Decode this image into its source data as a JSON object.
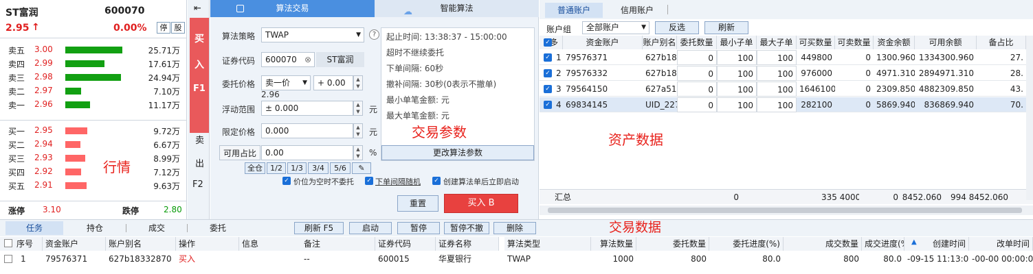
{
  "quote": {
    "name": "ST富润",
    "code": "600070",
    "price": "2.95",
    "arrow": "↑",
    "change_pct": "0.00%",
    "btn_stop": "停",
    "btn_stock": "股",
    "asks": [
      {
        "label": "卖五",
        "price": "3.00",
        "vol": "25.71万",
        "level": 0.83
      },
      {
        "label": "卖四",
        "price": "2.99",
        "vol": "17.61万",
        "level": 0.57
      },
      {
        "label": "卖三",
        "price": "2.98",
        "vol": "24.94万",
        "level": 0.81
      },
      {
        "label": "卖二",
        "price": "2.97",
        "vol": "7.10万",
        "level": 0.23
      },
      {
        "label": "卖一",
        "price": "2.96",
        "vol": "11.17万",
        "level": 0.36
      }
    ],
    "bids": [
      {
        "label": "买一",
        "price": "2.95",
        "vol": "9.72万",
        "level": 0.32
      },
      {
        "label": "买二",
        "price": "2.94",
        "vol": "6.67万",
        "level": 0.22
      },
      {
        "label": "买三",
        "price": "2.93",
        "vol": "8.99万",
        "level": 0.29
      },
      {
        "label": "买四",
        "price": "2.92",
        "vol": "7.12万",
        "level": 0.23
      },
      {
        "label": "买五",
        "price": "2.91",
        "vol": "9.63万",
        "level": 0.31
      }
    ],
    "annotation": "行情",
    "limit_up_label": "涨停",
    "limit_up": "3.10",
    "limit_down_label": "跌停",
    "limit_down": "2.80"
  },
  "side": {
    "collapse": "⇤",
    "buy": [
      "买",
      "入",
      "F1"
    ],
    "sell": [
      "卖",
      "出",
      "F2"
    ]
  },
  "algo": {
    "tab_algo": "算法交易",
    "tab_smart": "智能算法",
    "strategy_label": "算法策略",
    "strategy": "TWAP",
    "code_label": "证券代码",
    "code": "600070",
    "code_name": "ST富润",
    "price_label": "委托价格",
    "price_mode": "卖一价",
    "price_offset": "+ 0.00",
    "ref_price": "2.96",
    "float_label": "浮动范围",
    "float_value": "± 0.000",
    "unit_yuan": "元",
    "limit_label": "限定价格",
    "limit_value": "0.000",
    "ratio_label": "可用占比",
    "ratio_value": "0.00",
    "unit_pct": "%",
    "fractions": [
      "全仓",
      "1/2",
      "1/3",
      "3/4",
      "5/6"
    ],
    "cb_no_price": "价位为空时不委托",
    "cb_random": "下单间隔随机",
    "cb_autostart": "创建算法单后立即启动",
    "reset": "重置",
    "buy": "买入 B"
  },
  "params": {
    "lines": [
      "起止时间: 13:38:37 - 15:00:00",
      "超时不继续委托",
      "下单间隔: 60秒",
      "撤补间隔: 30秒(0表示不撤单)",
      "最小单笔金额: 元",
      "最大单笔金额: 元"
    ],
    "annotation": "交易参数",
    "change_btn": "更改算法参数"
  },
  "accounts": {
    "tab_normal": "普通账户",
    "tab_credit": "信用账户",
    "group_label": "账户组",
    "group_value": "全部账户",
    "invert": "反选",
    "refresh": "刷新",
    "annotation": "资产数据",
    "headers": [
      "多",
      "资金账户",
      "账户别名",
      "委托数量",
      "最小子单",
      "最大子单",
      "可买数量",
      "可卖数量",
      "资金余额",
      "可用余额",
      "备占比"
    ],
    "rows": [
      [
        "1",
        "79576371",
        "627b183",
        "0",
        "100",
        "100",
        "449800",
        "0",
        "1300.960",
        "1334300.960",
        "27."
      ],
      [
        "2",
        "79576332",
        "627b180",
        "0",
        "100",
        "100",
        "976000",
        "0",
        "4971.310",
        "2894971.310",
        "28."
      ],
      [
        "3",
        "79564150",
        "627a511",
        "0",
        "100",
        "100",
        "1646100",
        "0",
        "2309.850",
        "4882309.850",
        "43."
      ],
      [
        "4",
        "69834145",
        "UID_227",
        "0",
        "100",
        "100",
        "282100",
        "0",
        "5869.940",
        "836869.940",
        "70."
      ]
    ],
    "total_label": "汇总",
    "total_qty": "0",
    "total_buy": "335 4000",
    "total_sell": "0",
    "total_bal": "8452.060",
    "total_avail": "994 8452.060"
  },
  "bottom": {
    "tabs": [
      "任务",
      "持仓",
      "成交",
      "委托"
    ],
    "actions": [
      "刷新 F5",
      "启动",
      "暂停",
      "暂停不撤",
      "删除"
    ],
    "annotation": "交易数据",
    "headers": [
      "序号",
      "资金账户",
      "账户别名",
      "操作",
      "信息",
      "备注",
      "证券代码",
      "证券名称",
      "算法类型",
      "算法数量",
      "委托数量",
      "委托进度(%)",
      "成交数量",
      "成交进度(%)",
      "创建时间",
      "改单时间"
    ],
    "row": [
      "1",
      "79576371",
      "627b18332870",
      "买入",
      "",
      "--",
      "600015",
      "华夏银行",
      "TWAP",
      "1000",
      "800",
      "80.0",
      "800",
      "80.0",
      "-09-15 11:13:01",
      "-00-00 00:00:00"
    ]
  },
  "colors": {
    "red": "#e02020",
    "green": "#079a07",
    "bid_bar": "#ff6666",
    "ask_bar": "#12a012"
  }
}
